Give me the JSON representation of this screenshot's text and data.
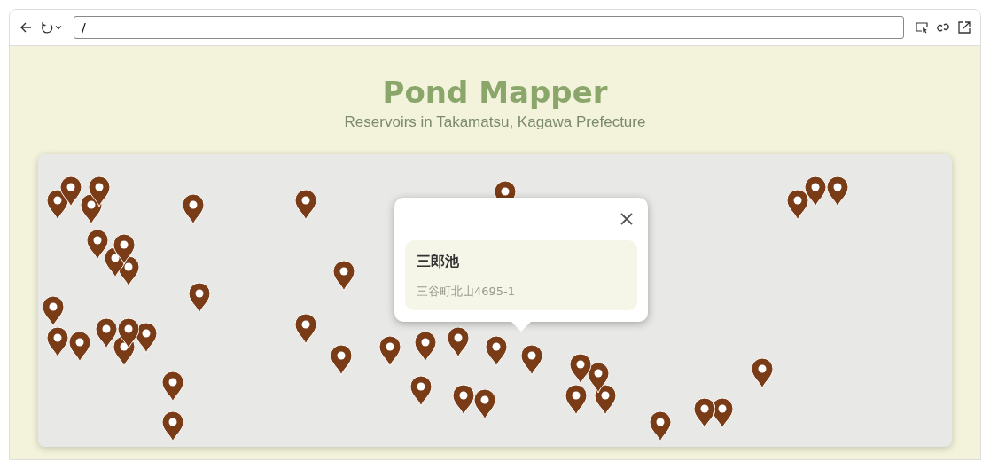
{
  "browser": {
    "address": "/"
  },
  "header": {
    "title": "Pond Mapper",
    "subtitle": "Reservoirs in Takamatsu, Kagawa Prefecture"
  },
  "popup": {
    "name": "三郎池",
    "address": "三谷町北山4695-1"
  }
}
